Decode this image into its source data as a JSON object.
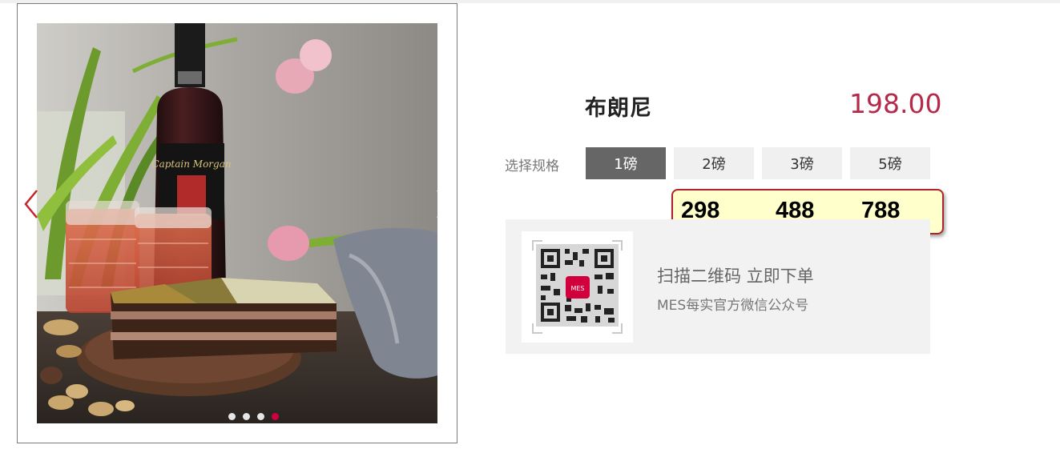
{
  "gallery": {
    "photo_alt": "cake-photo",
    "prev_icon": "chevron-left-icon",
    "next_icon": "chevron-right-icon",
    "dots": 4,
    "active_dot": 3,
    "accent": "#d1003c"
  },
  "product": {
    "name": "布朗尼",
    "price": "198.00",
    "price_color": "#b5294a"
  },
  "specs": {
    "label": "选择规格",
    "options": [
      "1磅",
      "2磅",
      "3磅",
      "5磅"
    ],
    "selected": "1磅"
  },
  "price_tooltip": {
    "values": [
      "298",
      "488",
      "788"
    ]
  },
  "wechat": {
    "scan_text": "扫描二维码 立即下单",
    "account_text": "MES每实官方微信公众号",
    "logo_text": "MES"
  }
}
